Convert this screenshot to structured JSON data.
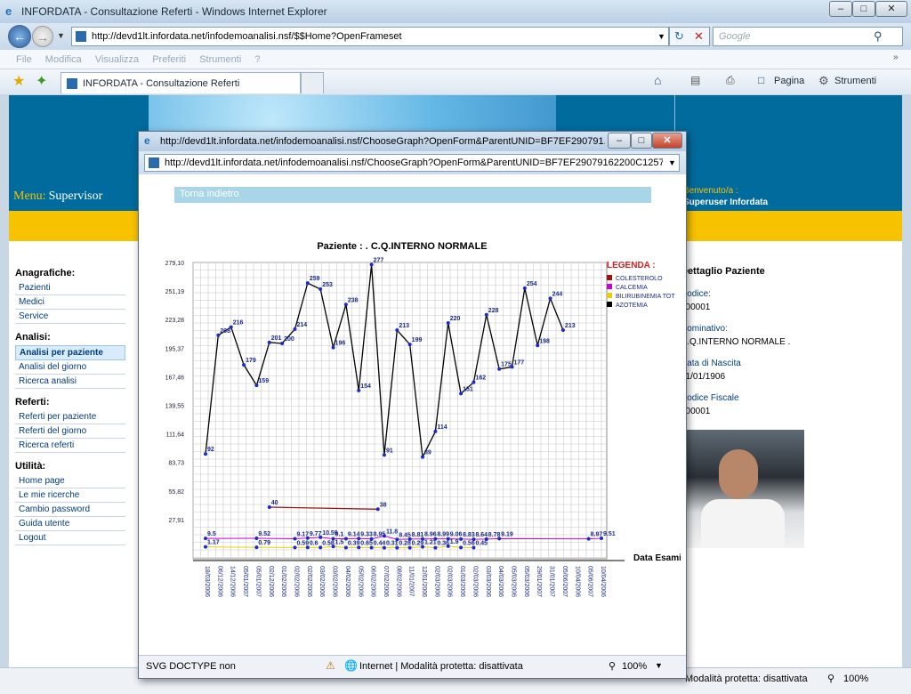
{
  "browser": {
    "title": "INFORDATA - Consultazione Referti - Windows Internet Explorer",
    "url": "http://devd1lt.infordata.net/infodemoanalisi.nsf/$$Home?OpenFrameset",
    "search_placeholder": "Google",
    "menus": [
      "File",
      "Modifica",
      "Visualizza",
      "Preferiti",
      "Strumenti",
      "?"
    ],
    "tab_label": "INFORDATA - Consultazione Referti",
    "toolbar": {
      "page_label": "Pagina",
      "tools_label": "Strumenti"
    },
    "status": {
      "text": "Modalità protetta: disattivata",
      "zoom": "100%"
    }
  },
  "page": {
    "menu_label": "Menu:",
    "user_role": "Supervisor",
    "welcome_label": "Benvenuto/a :",
    "welcome_user": "Superuser Infordata",
    "sections": [
      {
        "title": "Anagrafiche:",
        "items": [
          "Pazienti",
          "Medici",
          "Service"
        ]
      },
      {
        "title": "Analisi:",
        "items": [
          "Analisi per paziente",
          "Analisi del giorno",
          "Ricerca analisi"
        ]
      },
      {
        "title": "Referti:",
        "items": [
          "Referti per paziente",
          "Referti del giorno",
          "Ricerca referti"
        ]
      },
      {
        "title": "Utilità:",
        "items": [
          "Home page",
          "Le mie ricerche",
          "Cambio password",
          "Guida utente",
          "Logout"
        ]
      }
    ],
    "details": {
      "title": "Dettaglio Paziente",
      "code_label": "Codice:",
      "code": "000001",
      "name_label": "Nominativo:",
      "name": "C.Q.INTERNO NORMALE .",
      "dob_label": "Data di Nascita",
      "dob": "01/01/1906",
      "cf_label": "Codice Fiscale",
      "cf": "000001"
    }
  },
  "popup": {
    "title": "http://devd1lt.infordata.net/infodemoanalisi.nsf/ChooseGraph?OpenForm&ParentUNID=BF7EF290791...",
    "url": "http://devd1lt.infordata.net/infodemoanalisi.nsf/ChooseGraph?OpenForm&ParentUNID=BF7EF29079162200C125726C(",
    "back_label": "Torna indietro",
    "status_left": "SVG DOCTYPE non",
    "status_zone": "Internet | Modalità protetta: disattivata",
    "status_zoom": "100%"
  },
  "chart_data": {
    "type": "line",
    "title": "Paziente : . C.Q.INTERNO NORMALE",
    "xlabel": "Data Esami",
    "legend_title": "LEGENDA :",
    "legend_position": "right",
    "grid": true,
    "ylim": [
      0,
      279.1
    ],
    "yticks": [
      "279,10",
      "251,19",
      "223,28",
      "195,37",
      "167,46",
      "139,55",
      "111,64",
      "83,73",
      "55,82",
      "27,91"
    ],
    "categories": [
      "18/03/2006",
      "06/12/2006",
      "14/12/2006",
      "05/01/2007",
      "05/01/2007",
      "02/12/2006",
      "01/02/2006",
      "02/02/2006",
      "02/02/2006",
      "03/02/2006",
      "03/02/2006",
      "04/02/2006",
      "05/02/2006",
      "06/02/2006",
      "07/02/2006",
      "08/02/2006",
      "11/01/2007",
      "12/01/2006",
      "02/03/2006",
      "02/03/2006",
      "01/03/2006",
      "02/03/2006",
      "03/03/2006",
      "04/03/2006",
      "05/03/2006",
      "05/03/2006",
      "29/01/2007",
      "31/01/2007",
      "05/06/2007",
      "10/04/2006",
      "05/06/2007",
      "10/04/2006"
    ],
    "series": [
      {
        "name": "COLESTEROLO",
        "color": "#a01010",
        "points": [
          [
            5,
            40
          ],
          [
            13.5,
            38
          ]
        ]
      },
      {
        "name": "CALCEMIA",
        "color": "#d000d0",
        "points": [
          [
            0,
            9.5
          ],
          [
            4,
            9.52
          ],
          [
            7,
            9.17
          ],
          [
            8,
            9.77
          ],
          [
            9,
            10.59
          ],
          [
            10,
            9.1
          ],
          [
            11,
            9.14
          ],
          [
            12,
            9.33
          ],
          [
            13,
            8.95
          ],
          [
            14,
            11.8
          ],
          [
            15,
            8.45
          ],
          [
            16,
            8.81
          ],
          [
            17,
            8.96
          ],
          [
            18,
            8.99
          ],
          [
            19,
            9.06
          ],
          [
            20,
            8.83
          ],
          [
            21,
            8.64
          ],
          [
            22,
            8.78
          ],
          [
            23,
            9.19
          ],
          [
            30,
            8.97
          ],
          [
            31,
            9.51
          ]
        ]
      },
      {
        "name": "BILIRUBINEMIA TOT",
        "color": "#e8d000",
        "points": [
          [
            0,
            1.17
          ],
          [
            4,
            0.79
          ],
          [
            7,
            0.59
          ],
          [
            8,
            0.6
          ],
          [
            9,
            0.58
          ],
          [
            10,
            1.5
          ],
          [
            11,
            0.39
          ],
          [
            12,
            0.65
          ],
          [
            13,
            0.44
          ],
          [
            14,
            0.31
          ],
          [
            15,
            0.28
          ],
          [
            16,
            0.29
          ],
          [
            17,
            1.21
          ],
          [
            18,
            0.36
          ],
          [
            19,
            1.9
          ],
          [
            20,
            0.56
          ],
          [
            21,
            0.45
          ]
        ]
      },
      {
        "name": "AZOTEMIA",
        "color": "#000000",
        "points": [
          [
            0,
            92
          ],
          [
            1,
            208
          ],
          [
            2,
            216
          ],
          [
            3,
            179
          ],
          [
            4,
            159
          ],
          [
            5,
            201
          ],
          [
            6,
            200
          ],
          [
            7,
            214
          ],
          [
            8,
            259
          ],
          [
            9,
            253
          ],
          [
            10,
            196
          ],
          [
            11,
            238
          ],
          [
            12,
            154
          ],
          [
            13,
            277
          ],
          [
            14,
            91
          ],
          [
            15,
            213
          ],
          [
            16,
            199
          ],
          [
            17,
            89
          ],
          [
            18,
            114
          ],
          [
            19,
            220
          ],
          [
            20,
            151
          ],
          [
            21,
            162
          ],
          [
            22,
            228
          ],
          [
            23,
            175
          ],
          [
            24,
            177
          ],
          [
            25,
            254
          ],
          [
            26,
            198
          ],
          [
            27,
            244
          ],
          [
            28,
            213
          ]
        ]
      }
    ]
  }
}
